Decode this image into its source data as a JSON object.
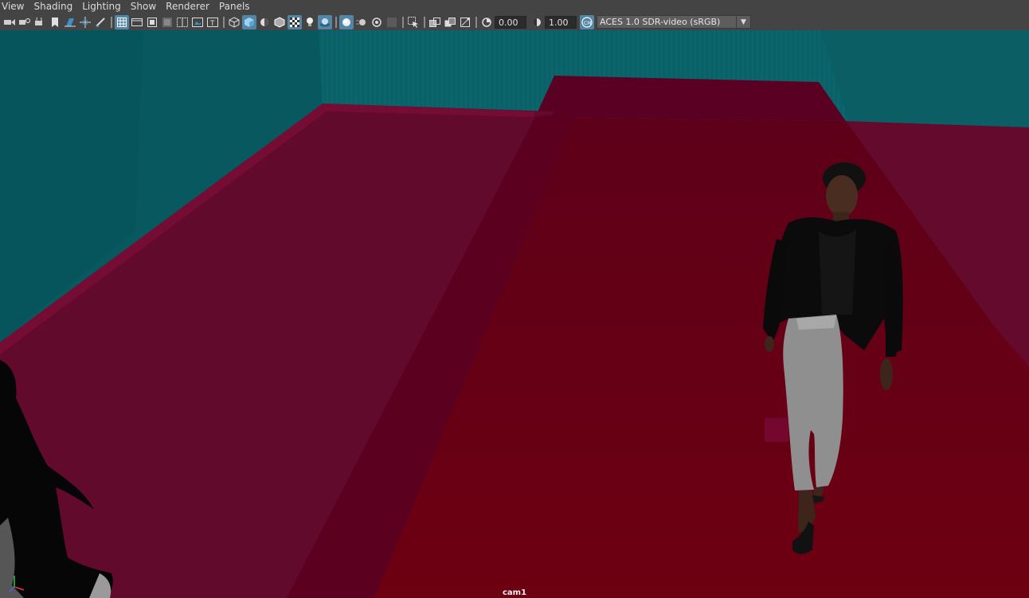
{
  "menu": {
    "view": "View",
    "shading": "Shading",
    "lighting": "Lighting",
    "show": "Show",
    "renderer": "Renderer",
    "panels": "Panels"
  },
  "toolbar": {
    "exposure_value": "0.00",
    "gamma_value": "1.00",
    "color_space": "ACES 1.0 SDR-video (sRGB)",
    "icons": [
      "select-camera-icon",
      "camera-attributes-icon",
      "bookmark-icon",
      "image-plane-icon",
      "2d-pan-zoom-icon",
      "grease-pencil-icon",
      "grid-icon",
      "film-gate-icon",
      "resolution-gate-icon",
      "gate-mask-icon",
      "field-chart-icon",
      "safe-action-icon",
      "safe-title-icon",
      "wireframe-icon",
      "smooth-shade-icon",
      "wireframe-on-shaded-icon",
      "textured-icon",
      "use-all-lights-icon",
      "shadows-icon",
      "screen-space-ao-icon",
      "motion-blur-icon",
      "anti-aliasing-icon",
      "depth-of-field-icon",
      "isolate-select-icon",
      "xray-icon",
      "xray-active-components-icon",
      "xray-joints-icon",
      "exposure-icon",
      "gamma-icon",
      "color-management-icon"
    ]
  },
  "viewport": {
    "camera_name": "cam1",
    "colors": {
      "wall": "#0a5f66",
      "floor": "#640a2c",
      "ramp": "#6a0014"
    }
  }
}
